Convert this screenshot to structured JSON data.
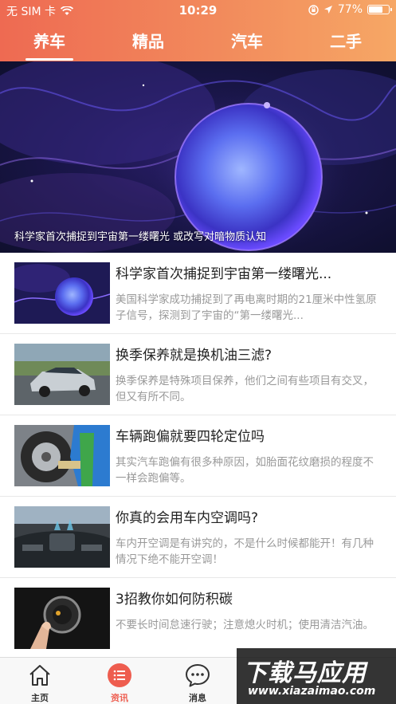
{
  "status_bar": {
    "carrier": "无 SIM 卡",
    "time": "10:29",
    "battery": "77%",
    "battery_level": 0.77
  },
  "tabs": [
    {
      "label": "养车",
      "active": true
    },
    {
      "label": "精品",
      "active": false
    },
    {
      "label": "汽车",
      "active": false
    },
    {
      "label": "二手",
      "active": false
    }
  ],
  "banner": {
    "caption": "科学家首次捕捉到宇宙第一缕曙光 或改写对暗物质认知"
  },
  "news": [
    {
      "title": "科学家首次捕捉到宇宙第一缕曙光...",
      "desc": "美国科学家成功捕捉到了再电离时期的21厘米中性氢原子信号，探测到了宇宙的“第一缕曙光...",
      "thumb": "cosmic-sphere"
    },
    {
      "title": "换季保养就是换机油三滤?",
      "desc": "换季保养是特殊项目保养，他们之间有些项目有交叉，但又有所不同。",
      "thumb": "silver-car"
    },
    {
      "title": "车辆跑偏就要四轮定位吗",
      "desc": "其实汽车跑偏有很多种原因，如胎面花纹磨损的程度不一样会跑偏等。",
      "thumb": "wheel-mechanic"
    },
    {
      "title": "你真的会用车内空调吗?",
      "desc": "车内开空调是有讲究的，不是什么时候都能开！有几种情况下绝不能开空调！",
      "thumb": "car-interior"
    },
    {
      "title": "3招教你如何防积碳",
      "desc": "不要长时间怠速行驶；注意熄火时机；使用清洁汽油。",
      "thumb": "start-button"
    }
  ],
  "bottom_nav": [
    {
      "label": "主页",
      "icon": "home-icon",
      "active": false
    },
    {
      "label": "资讯",
      "icon": "news-icon",
      "active": true
    },
    {
      "label": "消息",
      "icon": "message-icon",
      "active": false
    }
  ],
  "watermark": {
    "title": "下载马应用",
    "url": "www.xiazaimao.com"
  },
  "colors": {
    "header_start": "#ee6a52",
    "header_end": "#f6a765",
    "accent": "#ee5d4f"
  }
}
